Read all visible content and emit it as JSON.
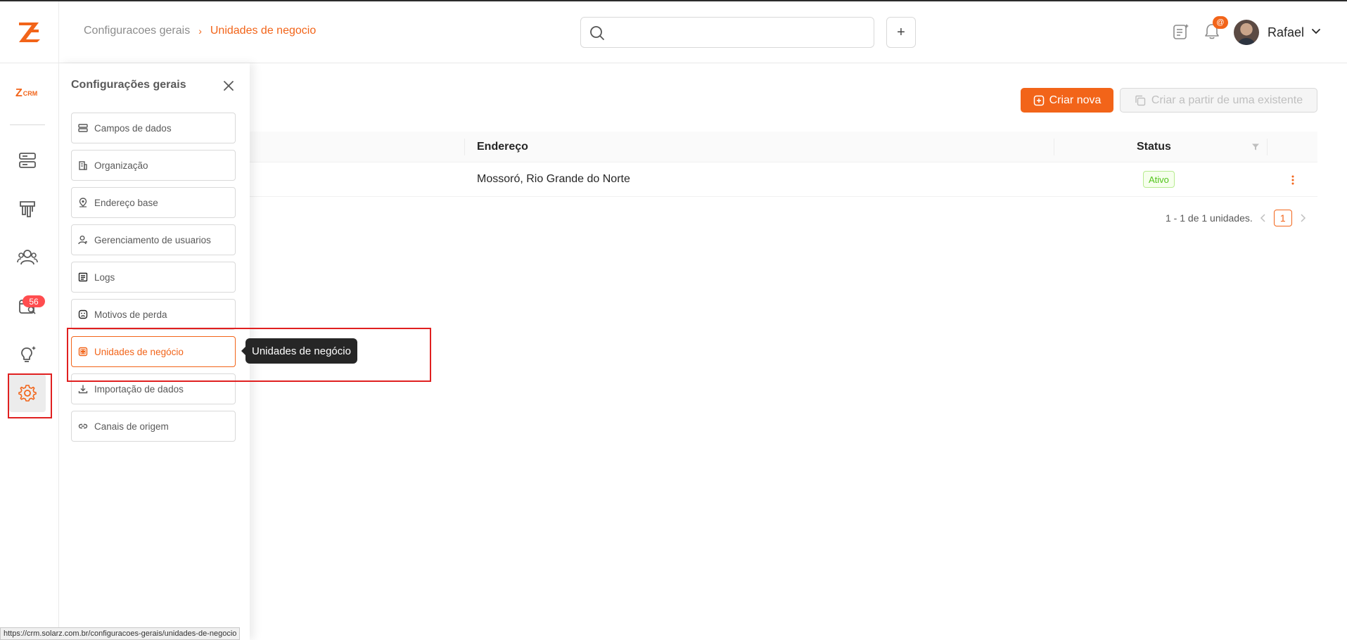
{
  "header": {
    "breadcrumb": [
      "Configuracoes gerais",
      "Unidades de negocio"
    ],
    "search_placeholder": "",
    "notification_count": "@",
    "user_name": "Rafael"
  },
  "rail": {
    "brand": "CRM",
    "badge_count": "56",
    "active_item": "settings"
  },
  "panel": {
    "title": "Configurações gerais",
    "items": [
      {
        "label": "Campos de dados",
        "icon": "database-icon"
      },
      {
        "label": "Organização",
        "icon": "building-icon"
      },
      {
        "label": "Endereço base",
        "icon": "location-icon"
      },
      {
        "label": "Gerenciamento de usuarios",
        "icon": "user-settings-icon"
      },
      {
        "label": "Logs",
        "icon": "log-icon"
      },
      {
        "label": "Motivos de perda",
        "icon": "sad-face-icon"
      },
      {
        "label": "Unidades de negócio",
        "icon": "business-unit-icon"
      },
      {
        "label": "Importação de dados",
        "icon": "download-icon"
      },
      {
        "label": "Canais de origem",
        "icon": "link-icon"
      }
    ],
    "active_index": 6,
    "tooltip": "Unidades de negócio"
  },
  "main": {
    "create_button": "Criar nova",
    "copy_button": "Criar a partir de uma existente",
    "table": {
      "columns": [
        "Endereço",
        "Status"
      ],
      "rows": [
        {
          "address": "Mossoró, Rio Grande do Norte",
          "status": "Ativo"
        }
      ]
    },
    "pagination": {
      "summary": "1 - 1 de 1 unidades.",
      "current_page": "1"
    }
  },
  "statusbar": {
    "url": "https://crm.solarz.com.br/configuracoes-gerais/unidades-de-negocio"
  },
  "colors": {
    "accent": "#f26419",
    "highlight": "#e02020",
    "status_active": "#52c41a"
  }
}
